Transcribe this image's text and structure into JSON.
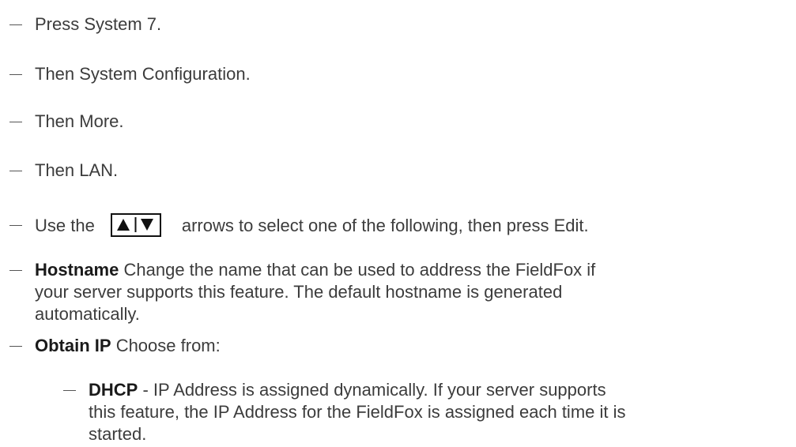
{
  "steps": [
    {
      "text": "Press System   7."
    },
    {
      "text": "Then System Configuration."
    },
    {
      "text": "Then More."
    },
    {
      "text": "Then LAN."
    }
  ],
  "arrows_step": {
    "before": "Use the",
    "after": "arrows to select one of the following, then press Edit.",
    "icon": "up-down-arrow-keys-icon"
  },
  "hostname": {
    "term": "Hostname",
    "line1": "Change the name that can be used to address the FieldFox if",
    "line2": "your server supports this feature. The default hostname is generated",
    "line3": "automatically."
  },
  "obtain_ip": {
    "term": "Obtain IP",
    "desc": "Choose from:"
  },
  "dhcp": {
    "term": "DHCP",
    "line1": "- IP Address is assigned dynamically. If your server supports",
    "line2": "this feature, the IP Address for the FieldFox is assigned each time it is",
    "line3": "started."
  }
}
